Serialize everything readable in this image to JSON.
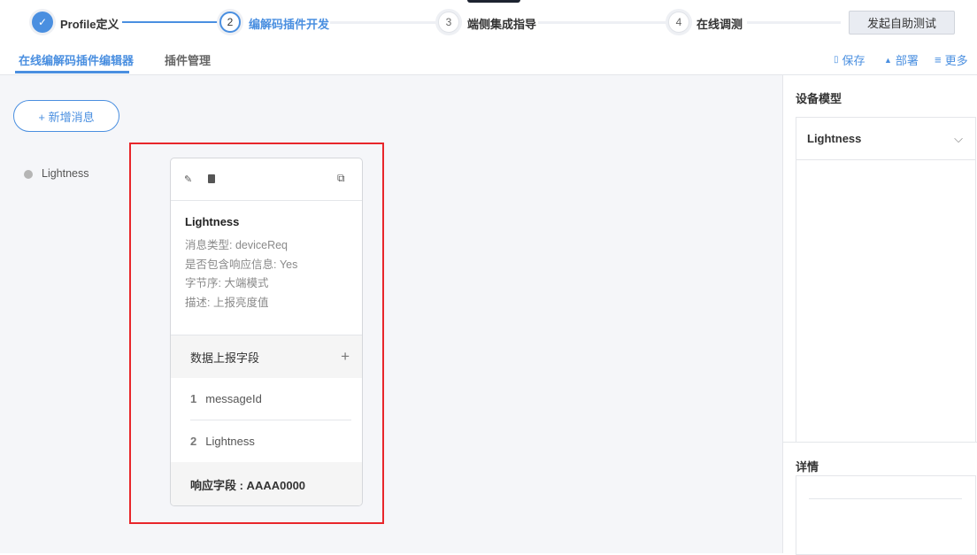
{
  "steps": [
    {
      "num": "",
      "label": "Profile定义",
      "state": "done"
    },
    {
      "num": "2",
      "label": "编解码插件开发",
      "state": "active"
    },
    {
      "num": "3",
      "label": "端侧集成指导",
      "state": "todo"
    },
    {
      "num": "4",
      "label": "在线调测",
      "state": "todo"
    }
  ],
  "self_test_button": "发起自助测试",
  "tabs": [
    "在线编解码插件编辑器",
    "插件管理"
  ],
  "actions": {
    "save": "保存",
    "deploy": "部署",
    "more": "更多"
  },
  "add_message_button": "+ 新增消息",
  "message_list": [
    {
      "label": "Lightness"
    }
  ],
  "card": {
    "title": "Lightness",
    "info": [
      "消息类型: deviceReq",
      "是否包含响应信息: Yes",
      "字节序: 大端模式",
      "描述: 上报亮度值"
    ],
    "section_title": "数据上报字段",
    "fields": [
      {
        "index": "1",
        "name": "messageId"
      },
      {
        "index": "2",
        "name": "Lightness"
      }
    ],
    "response": "响应字段 : AAAA0000"
  },
  "right_panel": {
    "model_title": "设备模型",
    "model_select": "Lightness",
    "detail_title": "详情"
  },
  "colors": {
    "accent": "#4a8fe0",
    "highlight": "#e8262b"
  }
}
